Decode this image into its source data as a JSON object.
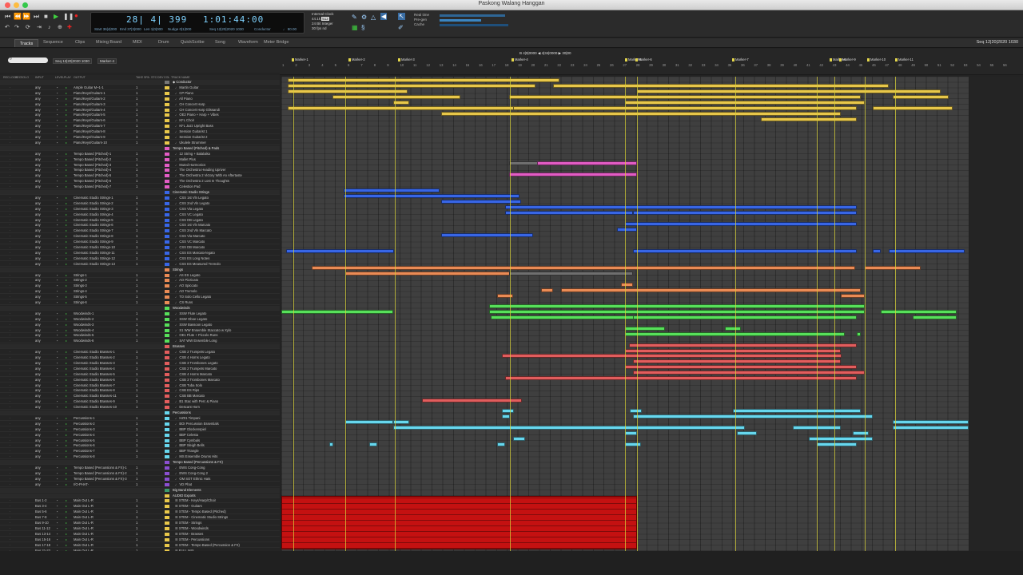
{
  "window": {
    "title": "Paskong Walang Hanggan"
  },
  "transport": {
    "counter_main": "28| 4| 399",
    "counter_time": "1:01:44:00",
    "start": "Start 36|4|000",
    "end": "End 37|3|000",
    "length": "Len 1|0|000",
    "nudge": "Nudge 0|1|000",
    "seq": "Seq 12|20|2020 1030",
    "conductor": "Conductor",
    "tempo": "♩ 90.00",
    "clock": [
      "Internal Clock",
      "44.1k",
      "24 Bit Integer",
      "30 fps nd"
    ],
    "clock_value": "512",
    "meter_labels": [
      "Real time",
      "Pre-gen",
      "Cache"
    ]
  },
  "tabs": [
    "Tracks",
    "Sequence",
    "Clips",
    "Mixing Board",
    "MIDI",
    "Drum",
    "QuickScribe",
    "Song",
    "Waveform",
    "Meter Bridge"
  ],
  "seq_right": "Seq 12|20|2020 1030",
  "filter": {
    "seq": "Seq 12|20|2020 1030",
    "marker": "Marker-4"
  },
  "ruler": {
    "position": "B  4|0|0000  ◀  4|34|0000  ▶  30|00",
    "markers": [
      "Marker-1",
      "Marker-2",
      "Marker-3",
      "Marker-4",
      "Marker-5",
      "Marker-6",
      "Marker-7",
      "Marker-8",
      "Marker-9",
      "Marker-10",
      "Marker-11"
    ]
  },
  "columns": [
    "REC",
    "LOCK",
    "SEC",
    "SOLO",
    "INPUT",
    "LEVEL",
    "PLAY",
    "OUTPUT",
    "TAKE",
    "SPA",
    "STC",
    "DEV",
    "COL",
    "TRACK NAME"
  ],
  "tracks": [
    {
      "in": "",
      "out": "",
      "name": "◆ Conductor",
      "folder": true,
      "color": "#777"
    },
    {
      "in": "any",
      "out": "Ample Guitar M~1-1",
      "name": "♩ Martin Guitar",
      "color": "#e8c74a"
    },
    {
      "in": "any",
      "out": "Piano/Keys/Guitars-1",
      "name": "♩ CP Piano",
      "color": "#e8c74a"
    },
    {
      "in": "any",
      "out": "Piano/Keys/Guitars-2",
      "name": "♩ All Piano",
      "color": "#e8c74a"
    },
    {
      "in": "any",
      "out": "Piano/Keys/Guitars-3",
      "name": "♩ CH Concert Harp",
      "color": "#e8c74a"
    },
    {
      "in": "any",
      "out": "Piano/Keys/Guitars-4",
      "name": "♩ CH Concert Harp Glissandi",
      "color": "#e8c74a"
    },
    {
      "in": "any",
      "out": "Piano/Keys/Guitars-5",
      "name": "♩ OE2 Piano + Harp + Vibes",
      "color": "#e8c74a"
    },
    {
      "in": "any",
      "out": "Piano/Keys/Guitars-6",
      "name": "♩ KFL Choir",
      "color": "#e8c74a"
    },
    {
      "in": "any",
      "out": "Piano/Keys/Guitars-7",
      "name": "♩ KFL Jazz Upright Bass",
      "color": "#e8c74a"
    },
    {
      "in": "any",
      "out": "Piano/Keys/Guitars-8",
      "name": "♩ Session Guitarist 1",
      "color": "#e8c74a"
    },
    {
      "in": "any",
      "out": "Piano/Keys/Guitars-9",
      "name": "♩ Session Guitarist 2",
      "color": "#e8c74a"
    },
    {
      "in": "any",
      "out": "Piano/Keys/Guitars-10",
      "name": "♩ Ukulele Strummer",
      "color": "#e8c74a"
    },
    {
      "in": "",
      "out": "",
      "name": "Tempo Based (Pitched) & Pads",
      "folder": true,
      "color": "#e25cc4"
    },
    {
      "in": "any",
      "out": "Tempo Based (Pitched)-1",
      "name": "♩ 12 String + Balalaika",
      "color": "#e25cc4"
    },
    {
      "in": "any",
      "out": "Tempo Based (Pitched)-2",
      "name": "♩ Mallet Plus",
      "color": "#e25cc4"
    },
    {
      "in": "any",
      "out": "Tempo Based (Pitched)-3",
      "name": "♩ Muted Harmonics",
      "color": "#e25cc4"
    },
    {
      "in": "any",
      "out": "Tempo Based (Pitched)-4",
      "name": "♩ The Orchestra Heading Upriver",
      "color": "#e25cc4"
    },
    {
      "in": "any",
      "out": "Tempo Based (Pitched)-5",
      "name": "♩ The Orchestra 2 Victory With An Aftertaste",
      "color": "#e25cc4"
    },
    {
      "in": "any",
      "out": "Tempo Based (Pitched)-6",
      "name": "♩ The Orchestra 2 Lost In Thoughts",
      "color": "#e25cc4"
    },
    {
      "in": "any",
      "out": "Tempo Based (Pitched)-7",
      "name": "♩ Celestion Pad",
      "color": "#e25cc4"
    },
    {
      "in": "",
      "out": "",
      "name": "Cinematic Studio Strings",
      "folder": true,
      "color": "#3866e6"
    },
    {
      "in": "any",
      "out": "Cinematic Studio Strings-1",
      "name": "♩ CSS 1st Vln Legato",
      "color": "#3866e6"
    },
    {
      "in": "any",
      "out": "Cinematic Studio Strings-2",
      "name": "♩ CSS 2nd Vln Legato",
      "color": "#3866e6"
    },
    {
      "in": "any",
      "out": "Cinematic Studio Strings-3",
      "name": "♩ CSS Vla Legato",
      "color": "#3866e6"
    },
    {
      "in": "any",
      "out": "Cinematic Studio Strings-4",
      "name": "♩ CSS VC Legato",
      "color": "#3866e6"
    },
    {
      "in": "any",
      "out": "Cinematic Studio Strings-5",
      "name": "♩ CSS DB Legato",
      "color": "#3866e6"
    },
    {
      "in": "any",
      "out": "Cinematic Studio Strings-6",
      "name": "♩ CSS 1st Vln Marcato",
      "color": "#3866e6"
    },
    {
      "in": "any",
      "out": "Cinematic Studio Strings-7",
      "name": "♩ CSS 2nd Vln Marcato",
      "color": "#3866e6"
    },
    {
      "in": "any",
      "out": "Cinematic Studio Strings-8",
      "name": "♩ CSS Vla Marcato",
      "color": "#3866e6"
    },
    {
      "in": "any",
      "out": "Cinematic Studio Strings-9",
      "name": "♩ CSS VC Marcato",
      "color": "#3866e6"
    },
    {
      "in": "any",
      "out": "Cinematic Studio Strings-10",
      "name": "♩ CSS DB Marcato",
      "color": "#3866e6"
    },
    {
      "in": "any",
      "out": "Cinematic Studio Strings-11",
      "name": "♩ CSS ES Marcato-legato",
      "color": "#3866e6"
    },
    {
      "in": "any",
      "out": "Cinematic Studio Strings-12",
      "name": "♩ CSS ES Long Notes",
      "color": "#3866e6"
    },
    {
      "in": "any",
      "out": "Cinematic Studio Strings-13",
      "name": "♩ CSS ES Measured Tremolo",
      "color": "#3866e6"
    },
    {
      "in": "",
      "out": "",
      "name": "Strings",
      "folder": true,
      "color": "#ea8b55"
    },
    {
      "in": "any",
      "out": "Strings-1",
      "name": "♩ AS ES Legato",
      "color": "#ea8b55"
    },
    {
      "in": "any",
      "out": "Strings-2",
      "name": "♩ AO Pizzicato",
      "color": "#ea8b55"
    },
    {
      "in": "any",
      "out": "Strings-3",
      "name": "♩ AO Spiccato",
      "color": "#ea8b55"
    },
    {
      "in": "any",
      "out": "Strings-4",
      "name": "♩ AO Tremolo",
      "color": "#ea8b55"
    },
    {
      "in": "any",
      "out": "Strings-5",
      "name": "♩ TO Solo Cello Legato",
      "color": "#ea8b55"
    },
    {
      "in": "any",
      "out": "Strings-6",
      "name": "♩ CS Runs",
      "color": "#ea8b55"
    },
    {
      "in": "",
      "out": "",
      "name": "Woodwinds",
      "folder": true,
      "color": "#57e05a"
    },
    {
      "in": "any",
      "out": "Woodwinds-1",
      "name": "♩ SSW Flute Legato",
      "color": "#57e05a"
    },
    {
      "in": "any",
      "out": "Woodwinds-2",
      "name": "♩ SSW Oboe Legato",
      "color": "#57e05a"
    },
    {
      "in": "any",
      "out": "Woodwinds-3",
      "name": "♩ SSW Bassoon Legato",
      "color": "#57e05a"
    },
    {
      "in": "any",
      "out": "Woodwinds-4",
      "name": "♩ S1 WW Ensemble Staccato w Xylo",
      "color": "#57e05a"
    },
    {
      "in": "any",
      "out": "Woodwinds-5",
      "name": "♩ OE1 Flute + Piccolo Runs",
      "color": "#57e05a"
    },
    {
      "in": "any",
      "out": "Woodwinds-6",
      "name": "♩ SAT WW Ensemble Long",
      "color": "#57e05a"
    },
    {
      "in": "",
      "out": "",
      "name": "Brasses",
      "folder": true,
      "color": "#e25d5d"
    },
    {
      "in": "any",
      "out": "Cinematic Studio Brasses-1",
      "name": "♩ CSB 2 Trumpets Legato",
      "color": "#e25d5d"
    },
    {
      "in": "any",
      "out": "Cinematic Studio Brasses-2",
      "name": "♩ CSB 4 Horns Legato",
      "color": "#e25d5d"
    },
    {
      "in": "any",
      "out": "Cinematic Studio Brasses-3",
      "name": "♩ CSB 3 Trombones Legato",
      "color": "#e25d5d"
    },
    {
      "in": "any",
      "out": "Cinematic Studio Brasses-4",
      "name": "♩ CSB 2 Trumpets Marcato",
      "color": "#e25d5d"
    },
    {
      "in": "any",
      "out": "Cinematic Studio Brasses-5",
      "name": "♩ CSB 4 Horns Marcato",
      "color": "#e25d5d"
    },
    {
      "in": "any",
      "out": "Cinematic Studio Brasses-6",
      "name": "♩ CSB 3 Trombones Marcato",
      "color": "#e25d5d"
    },
    {
      "in": "any",
      "out": "Cinematic Studio Brasses-7",
      "name": "♩ CSB Tuba Solo",
      "color": "#e25d5d"
    },
    {
      "in": "any",
      "out": "Cinematic Studio Brasses-8",
      "name": "♩ CSB ES Rips",
      "color": "#e25d5d"
    },
    {
      "in": "any",
      "out": "Cinematic Studio Brasses-11",
      "name": "♩ CSB BB Marcato",
      "color": "#e25d5d"
    },
    {
      "in": "any",
      "out": "Cinematic Studio Brasses-9",
      "name": "♩ B1 Stac with Perc & Piano",
      "color": "#e25d5d"
    },
    {
      "in": "any",
      "out": "Cinematic Studio Brasses-10",
      "name": "♩ Descant Horn",
      "color": "#e25d5d"
    },
    {
      "in": "",
      "out": "",
      "name": "Percussions",
      "folder": true,
      "color": "#67d7ee"
    },
    {
      "in": "any",
      "out": "Percussions-1",
      "name": "♩ HZ01 Timpani",
      "color": "#67d7ee"
    },
    {
      "in": "any",
      "out": "Percussions-2",
      "name": "♩ BOI Percussion Essentials",
      "color": "#67d7ee"
    },
    {
      "in": "any",
      "out": "Percussions-3",
      "name": "♩ BBP Glockenspiel",
      "color": "#67d7ee"
    },
    {
      "in": "any",
      "out": "Percussions-4",
      "name": "♩ BBP Celesta",
      "color": "#67d7ee"
    },
    {
      "in": "any",
      "out": "Percussions-5",
      "name": "♩ BBP Cymbals",
      "color": "#67d7ee"
    },
    {
      "in": "any",
      "out": "Percussions-6",
      "name": "♩ BBP Sleigh Bells",
      "color": "#67d7ee"
    },
    {
      "in": "any",
      "out": "Percussions-7",
      "name": "♩ BBP Triangle",
      "color": "#67d7ee"
    },
    {
      "in": "any",
      "out": "Percussions-8",
      "name": "♩ MS Ensemble Drums Hits",
      "color": "#67d7ee"
    },
    {
      "in": "",
      "out": "",
      "name": "Tempo Based (Percussions & FX)",
      "folder": true,
      "color": "#8a4fd0"
    },
    {
      "in": "any",
      "out": "Tempo Based (Percussions & FX)-1",
      "name": "♩ EWS Cong-Cong",
      "color": "#8a4fd0"
    },
    {
      "in": "any",
      "out": "Tempo Based (Percussions & FX)-2",
      "name": "♩ EWS Cong-Cong 2",
      "color": "#8a4fd0"
    },
    {
      "in": "any",
      "out": "Tempo Based (Percussions & FX)-3",
      "name": "♩ OM SOT Ethnic Hats",
      "color": "#8a4fd0"
    },
    {
      "in": "any",
      "out": "I/O-PHAT-",
      "name": "♩ VD Phat",
      "color": "#8a4fd0"
    },
    {
      "in": "",
      "out": "",
      "name": "Big Band Elements",
      "folder": true,
      "color": "#3a9a6a"
    },
    {
      "in": "",
      "out": "",
      "name": "AUDIO Exports",
      "folder": true,
      "color": "#e8c74a"
    },
    {
      "in": "Bus 1-2",
      "out": "Main Out L-R",
      "name": "☰ STEM - Keys/Harp/Choir",
      "color": "#e8c74a"
    },
    {
      "in": "Bus 3-4",
      "out": "Main Out L-R",
      "name": "☰ STEM - Guitars",
      "color": "#e8c74a"
    },
    {
      "in": "Bus 5-6",
      "out": "Main Out L-R",
      "name": "☰ STEM - Tempo Based (Pitched)",
      "color": "#e8c74a"
    },
    {
      "in": "Bus 7-8",
      "out": "Main Out L-R",
      "name": "☰ STEM - Cinematic Studio Strings",
      "color": "#e8c74a"
    },
    {
      "in": "Bus 9-10",
      "out": "Main Out L-R",
      "name": "☰ STEM - Strings",
      "color": "#e8c74a"
    },
    {
      "in": "Bus 11-12",
      "out": "Main Out L-R",
      "name": "☰ STEM - Woodwinds",
      "color": "#e8c74a"
    },
    {
      "in": "Bus 13-14",
      "out": "Main Out L-R",
      "name": "☰ STEM - Brasses",
      "color": "#e8c74a"
    },
    {
      "in": "Bus 15-16",
      "out": "Main Out L-R",
      "name": "☰ STEM - Percussions",
      "color": "#e8c74a"
    },
    {
      "in": "Bus 17-18",
      "out": "Main Out L-R",
      "name": "☰ STEM - Tempo Based (Percussion & FX)",
      "color": "#e8c74a"
    },
    {
      "in": "Bus 21-22",
      "out": "Main Out L-R",
      "name": "☰ FULL MIX",
      "color": "#e8c74a"
    }
  ]
}
